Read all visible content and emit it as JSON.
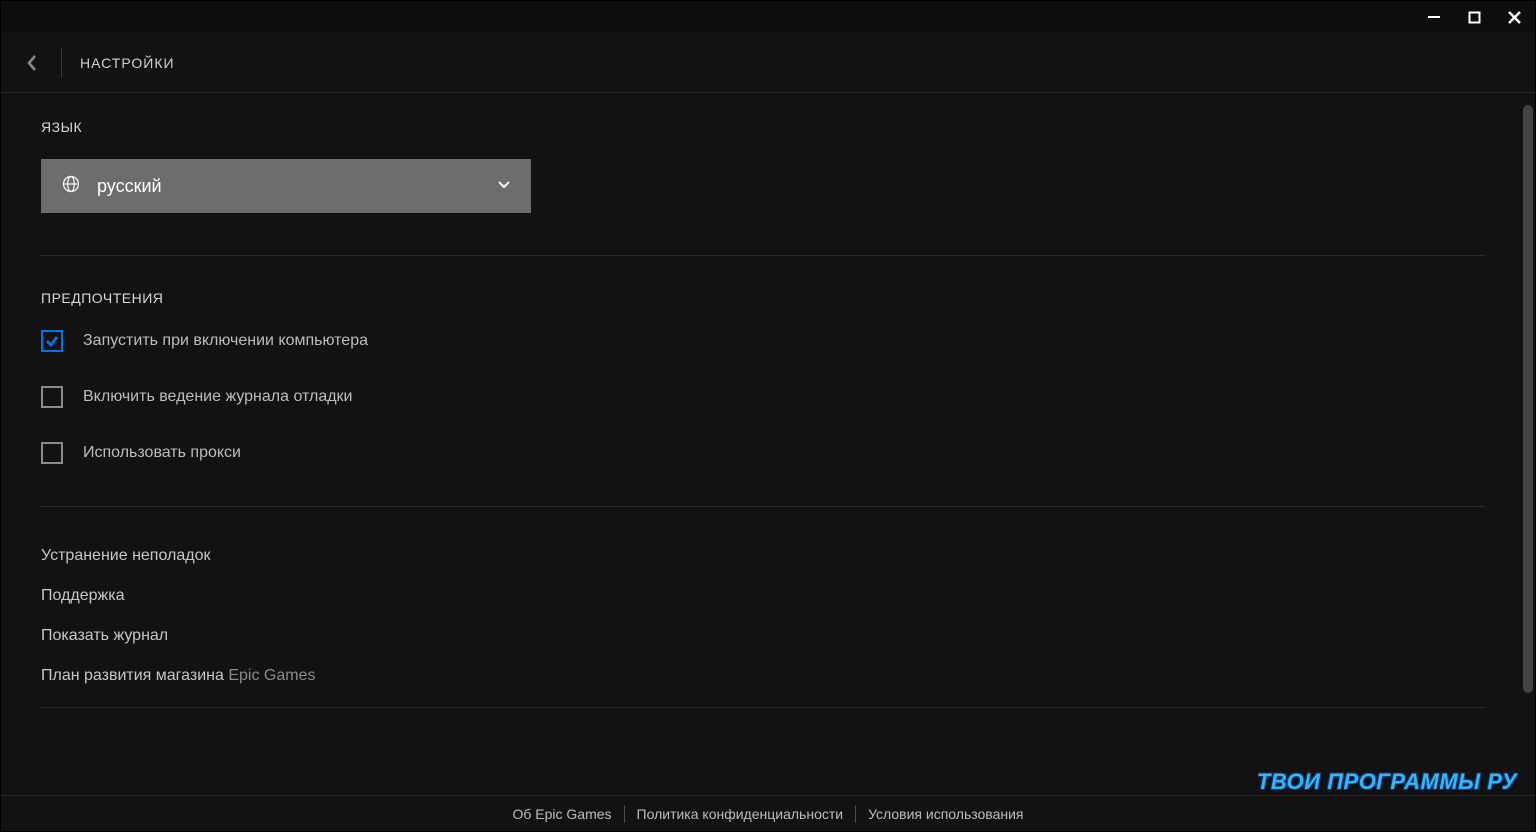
{
  "header": {
    "title": "НАСТРОЙКИ"
  },
  "language": {
    "heading": "ЯЗЫК",
    "selected": "русский"
  },
  "preferences": {
    "heading": "ПРЕДПОЧТЕНИЯ",
    "items": [
      {
        "label": "Запустить при включении компьютера",
        "checked": true
      },
      {
        "label": "Включить ведение журнала отладки",
        "checked": false
      },
      {
        "label": "Использовать прокси",
        "checked": false
      }
    ]
  },
  "links": [
    {
      "label": "Устранение неполадок"
    },
    {
      "label": "Поддержка"
    },
    {
      "label": "Показать журнал"
    },
    {
      "label": "План развития магазина ",
      "brand": "Epic Games"
    }
  ],
  "footer": {
    "about": "Об Epic Games",
    "privacy": "Политика конфиденциальности",
    "terms": "Условия использования"
  },
  "watermark": "ТВОИ ПРОГРАММЫ РУ"
}
